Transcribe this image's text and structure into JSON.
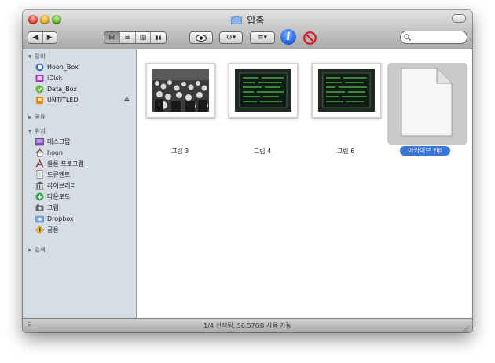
{
  "window": {
    "title": "압축"
  },
  "toolbar": {
    "back_glyph": "◀",
    "forward_glyph": "▶",
    "view_modes": [
      {
        "name": "icon-view",
        "glyph": "⊞",
        "active": true
      },
      {
        "name": "list-view",
        "glyph": "≣",
        "active": false
      },
      {
        "name": "column-view",
        "glyph": "▥",
        "active": false
      },
      {
        "name": "coverflow-view",
        "glyph": "▮▮",
        "active": false
      }
    ],
    "quicklook_glyph": "◉",
    "action_glyph": "⚙▾",
    "arrange_glyph": "≡▾",
    "info_glyph": "i",
    "search_placeholder": ""
  },
  "sidebar": {
    "devices_header": "장비",
    "devices": [
      {
        "label": "Hoon_Box",
        "icon": "dropbox-disk-icon",
        "color": "#3b6fd1"
      },
      {
        "label": "iDisk",
        "icon": "idisk-icon",
        "color": "#a23fb5"
      },
      {
        "label": "Data_Box",
        "icon": "data-disk-icon",
        "color": "#5fb63a"
      },
      {
        "label": "UNTITLED",
        "icon": "usb-disk-icon",
        "color": "#e08a1c",
        "eject": "⏏"
      }
    ],
    "shared_header": "공유",
    "places_header": "위치",
    "places": [
      {
        "label": "데스크탑",
        "icon": "desktop-icon"
      },
      {
        "label": "hoon",
        "icon": "home-icon"
      },
      {
        "label": "응용 프로그램",
        "icon": "applications-icon"
      },
      {
        "label": "도큐멘트",
        "icon": "documents-icon"
      },
      {
        "label": "라이브러리",
        "icon": "library-icon"
      },
      {
        "label": "다운로드",
        "icon": "downloads-icon"
      },
      {
        "label": "그림",
        "icon": "pictures-icon"
      },
      {
        "label": "Dropbox",
        "icon": "dropbox-folder-icon"
      },
      {
        "label": "공용",
        "icon": "public-icon"
      }
    ],
    "search_header": "검색"
  },
  "files": [
    {
      "name": "그림 3",
      "icon": "crowd-photo-thumbnail"
    },
    {
      "name": "그림 4",
      "icon": "green-screen-thumbnail"
    },
    {
      "name": "그림 6",
      "icon": "green-screen-thumbnail"
    },
    {
      "name": "아카이브.zip",
      "icon": "zip-document-icon",
      "selected": true
    }
  ],
  "status": {
    "text": "1/4 선택됨, 56.57GB 사용 가능"
  },
  "colors": {
    "selection": "#3875d7",
    "sidebar_bg": "#d6dde5"
  }
}
